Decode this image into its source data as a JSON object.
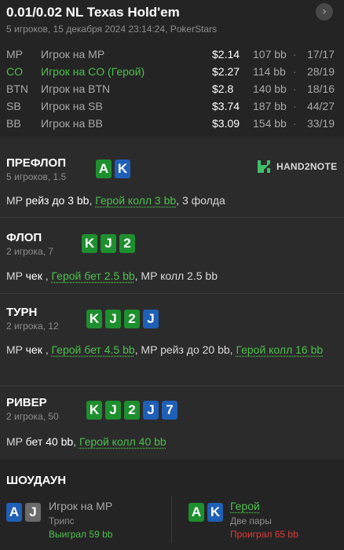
{
  "header": {
    "title": "0.01/0.02 NL Texas Hold'em",
    "subtitle": "5 игроков, 15 декабря 2024 23:14:24, PokerStars",
    "nav_icon": "chevron-right-icon"
  },
  "players": [
    {
      "pos": "MP",
      "name": "Игрок на MP",
      "stack": "$2.14",
      "bb": "107 bb",
      "sep": "·",
      "vpip": "17/17",
      "hero": false
    },
    {
      "pos": "CO",
      "name": "Игрок на CO (Герой)",
      "stack": "$2.27",
      "bb": "114 bb",
      "sep": "·",
      "vpip": "28/19",
      "hero": true
    },
    {
      "pos": "BTN",
      "name": "Игрок на BTN",
      "stack": "$2.8",
      "bb": "140 bb",
      "sep": "·",
      "vpip": "18/16",
      "hero": false
    },
    {
      "pos": "SB",
      "name": "Игрок на SB",
      "stack": "$3.74",
      "bb": "187 bb",
      "sep": "·",
      "vpip": "44/27",
      "hero": false
    },
    {
      "pos": "BB",
      "name": "Игрок на BB",
      "stack": "$3.09",
      "bb": "154 bb",
      "sep": "·",
      "vpip": "33/19",
      "hero": false
    }
  ],
  "brand": {
    "text": "HAND2NOTE",
    "color": "#3fbf6a"
  },
  "colors": {
    "hero": "#4cc14c",
    "lost": "#e03a3a",
    "card_green": "#1e8f2e",
    "card_blue": "#1f5fb5",
    "card_grey": "#6a6a6a"
  },
  "streets": {
    "preflop": {
      "title": "ПРЕФЛОП",
      "sub": "5 игроков, 1.5",
      "cards": [
        {
          "rank": "A",
          "suit": "green"
        },
        {
          "rank": "K",
          "suit": "blue"
        }
      ],
      "a1": "MP",
      "a2": "рейз до 3 bb",
      "a3": ",",
      "a4": "Герой колл 3 bb",
      "a5": ", 3 фолда"
    },
    "flop": {
      "title": "ФЛОП",
      "sub": "2 игрока, 7",
      "cards": [
        {
          "rank": "K",
          "suit": "green"
        },
        {
          "rank": "J",
          "suit": "green"
        },
        {
          "rank": "2",
          "suit": "green"
        }
      ],
      "a1": "MP",
      "a2": "чек",
      "a3": ",",
      "a4": "Герой бет 2.5 bb",
      "a5": ", MP колл 2.5 bb"
    },
    "turn": {
      "title": "ТУРН",
      "sub": "2 игрока, 12",
      "cards": [
        {
          "rank": "K",
          "suit": "green"
        },
        {
          "rank": "J",
          "suit": "green"
        },
        {
          "rank": "2",
          "suit": "green"
        },
        {
          "rank": "J",
          "suit": "blue"
        }
      ],
      "a1": "MP",
      "a2": "чек",
      "a3": ",",
      "a4": "Герой бет 4.5 bb",
      "a5": ", MP рейз до 20 bb,",
      "a6": "Герой колл 16 bb"
    },
    "river": {
      "title": "РИВЕР",
      "sub": "2 игрока, 50",
      "cards": [
        {
          "rank": "K",
          "suit": "green"
        },
        {
          "rank": "J",
          "suit": "green"
        },
        {
          "rank": "2",
          "suit": "green"
        },
        {
          "rank": "J",
          "suit": "blue"
        },
        {
          "rank": "7",
          "suit": "blue"
        }
      ],
      "a1": "MP",
      "a2": "бет 40 bb",
      "a3": ",",
      "a4": "Герой колл 40 bb"
    }
  },
  "showdown": {
    "title": "ШОУДАУН",
    "left": {
      "cards": [
        {
          "rank": "A",
          "suit": "blue"
        },
        {
          "rank": "J",
          "suit": "grey"
        }
      ],
      "name": "Игрок на MP",
      "hand": "Трипс",
      "result": "Выиграл 59 bb"
    },
    "right": {
      "cards": [
        {
          "rank": "A",
          "suit": "green"
        },
        {
          "rank": "K",
          "suit": "blue"
        }
      ],
      "name": "Герой",
      "hand": "Две пары",
      "result": "Проиграл 65 bb"
    }
  }
}
